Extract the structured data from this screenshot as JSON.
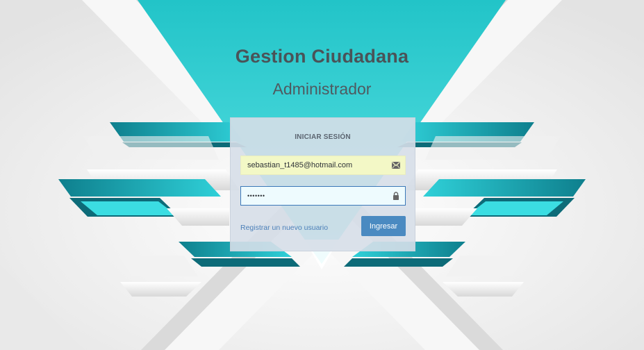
{
  "header": {
    "title": "Gestion Ciudadana",
    "subtitle": "Administrador"
  },
  "login": {
    "heading": "INICIAR SESIÓN",
    "email_value": "sebastian_t1485@hotmail.com",
    "email_icon": "envelope-icon",
    "password_value": "•••••••",
    "password_icon": "lock-icon",
    "register_link": "Registrar un nuevo usuario",
    "submit_label": "Ingresar"
  },
  "colors": {
    "teal": "#2ec9cf",
    "teal_dark": "#137f8c",
    "button": "#4a8ac1",
    "link": "#4b7fb8"
  }
}
